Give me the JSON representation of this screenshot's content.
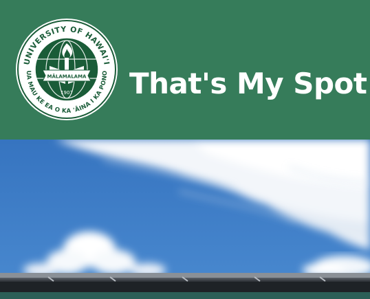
{
  "header": {
    "title": "That's My Spot!",
    "background_color": "#367c5a",
    "seal": {
      "icon": "university-seal-icon",
      "top_text": "UNIVERSITY OF HAWAI'I",
      "bottom_text": "UA MAU KE EA O KA 'ĀINA I KA PONO",
      "ribbon_text": "MĀLAMALAMA",
      "year": "1907"
    }
  },
  "hero": {
    "image": "sky-with-clouds-and-building-roof",
    "sky_color": "#3d7ac2"
  }
}
